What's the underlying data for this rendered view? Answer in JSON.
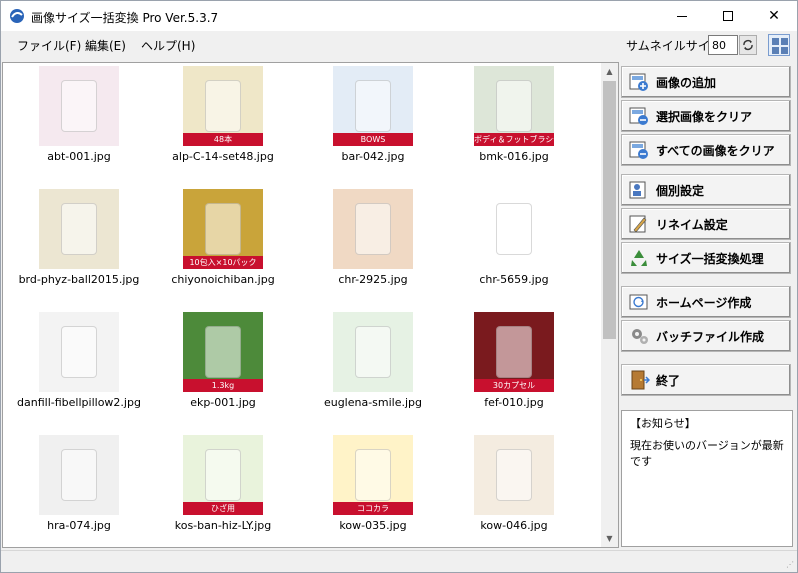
{
  "window": {
    "title": "画像サイズ一括変換 Pro Ver.5.3.7"
  },
  "menu": {
    "file": "ファイル(F)",
    "edit": "編集(E)",
    "help": "ヘルプ(H)"
  },
  "toolbar": {
    "thumbnail_size_label": "サムネイルサイズ",
    "thumbnail_size_value": "80"
  },
  "images": [
    {
      "name": "abt-001.jpg",
      "color": "#f5e9ef"
    },
    {
      "name": "alp-C-14-set48.jpg",
      "color": "#efe7c8",
      "badge": "48本"
    },
    {
      "name": "bar-042.jpg",
      "color": "#e3ecf6",
      "badge": "BOWS"
    },
    {
      "name": "bmk-016.jpg",
      "color": "#dde6d8",
      "badge": "ボディ＆フットブラシセット"
    },
    {
      "name": "brd-phyz-ball2015.jpg",
      "color": "#ece6d2"
    },
    {
      "name": "chiyonoichiban.jpg",
      "color": "#c9a43a",
      "badge": "10包入×10パック"
    },
    {
      "name": "chr-2925.jpg",
      "color": "#f0d9c4"
    },
    {
      "name": "chr-5659.jpg",
      "color": "#ffffff"
    },
    {
      "name": "danfill-fibellpillow2.jpg",
      "color": "#f3f3f3"
    },
    {
      "name": "ekp-001.jpg",
      "color": "#4d8a3a",
      "badge": "1.3kg"
    },
    {
      "name": "euglena-smile.jpg",
      "color": "#e6f2e4"
    },
    {
      "name": "fef-010.jpg",
      "color": "#7a1a1e",
      "badge": "30カプセル"
    },
    {
      "name": "hra-074.jpg",
      "color": "#f0f0f0"
    },
    {
      "name": "kos-ban-hiz-LY.jpg",
      "color": "#e9f3dc",
      "badge": "ひざ用"
    },
    {
      "name": "kow-035.jpg",
      "color": "#fff3c8",
      "badge": "ココカラ"
    },
    {
      "name": "kow-046.jpg",
      "color": "#f4ece0"
    }
  ],
  "actions": {
    "add_images": "画像の追加",
    "clear_selected": "選択画像をクリア",
    "clear_all": "すべての画像をクリア",
    "individual_settings": "個別設定",
    "rename_settings": "リネイム設定",
    "batch_resize": "サイズ一括変換処理",
    "create_webpage": "ホームページ作成",
    "create_batch": "バッチファイル作成",
    "exit": "終了"
  },
  "notice": {
    "heading": "【お知らせ】",
    "body": "現在お使いのバージョンが最新です"
  }
}
